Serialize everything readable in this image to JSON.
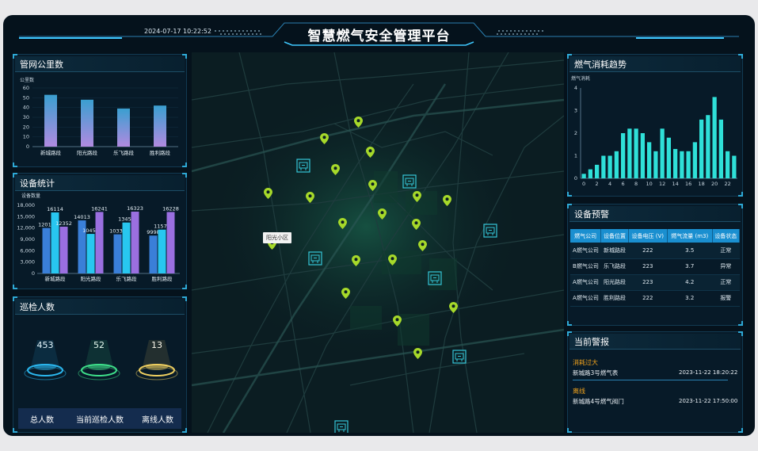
{
  "header": {
    "title": "智慧燃气安全管理平台",
    "datetime": "2024-07-17 10:22:52"
  },
  "pipeline": {
    "title": "管网公里数",
    "chart_data": {
      "type": "bar",
      "ylabel": "公里数",
      "ylim": [
        0,
        60
      ],
      "yticks": [
        0,
        10,
        20,
        30,
        40,
        50,
        60
      ],
      "categories": [
        "新城路段",
        "阳光路段",
        "乐飞路段",
        "胜利路段"
      ],
      "values": [
        53,
        48,
        39,
        42
      ],
      "colors": [
        "#3a9fd0",
        "#b18ae0"
      ]
    }
  },
  "devices": {
    "title": "设备统计",
    "chart_data": {
      "type": "bar",
      "ylabel": "设备数量",
      "ylim": [
        0,
        18000
      ],
      "yticks": [
        0,
        3000,
        6000,
        9000,
        12000,
        15000,
        18000
      ],
      "categories": [
        "新城路段",
        "阳光路段",
        "乐飞路段",
        "胜利路段"
      ],
      "series": [
        {
          "values": [
            12012,
            14013,
            10332,
            9998
          ],
          "color": "#3a7fd8"
        },
        {
          "values": [
            16114,
            10450,
            13451,
            11573
          ],
          "color": "#28c7f0"
        },
        {
          "values": [
            12352,
            16241,
            16323,
            16228
          ],
          "color": "#9a6fe0"
        }
      ]
    }
  },
  "patrol": {
    "title": "巡检人数",
    "items": [
      {
        "count": "453",
        "label": "总人数",
        "color": "#2bb8f0"
      },
      {
        "count": "52",
        "label": "当前巡检人数",
        "color": "#3ee08a"
      },
      {
        "count": "13",
        "label": "离线人数",
        "color": "#f0d060"
      }
    ]
  },
  "map": {
    "area_label": "阳光小区"
  },
  "consumption": {
    "title": "燃气消耗趋势",
    "chart_data": {
      "type": "bar",
      "ylabel": "燃气消耗",
      "ylim": [
        0,
        4
      ],
      "yticks": [
        0,
        1,
        2,
        3,
        4
      ],
      "x": [
        0,
        1,
        2,
        3,
        4,
        5,
        6,
        7,
        8,
        9,
        10,
        11,
        12,
        13,
        14,
        15,
        16,
        17,
        18,
        19,
        20,
        21,
        22,
        23
      ],
      "xticks": [
        0,
        2,
        4,
        6,
        8,
        10,
        12,
        14,
        16,
        18,
        20,
        22
      ],
      "values": [
        0.2,
        0.4,
        0.6,
        1.0,
        1.0,
        1.2,
        2.0,
        2.2,
        2.2,
        2.0,
        1.6,
        1.2,
        2.2,
        1.8,
        1.3,
        1.2,
        1.2,
        1.6,
        2.6,
        2.8,
        3.6,
        2.6,
        1.2,
        1.0
      ],
      "color": "#2fe0d8"
    }
  },
  "alerts": {
    "title": "设备预警",
    "columns": [
      "燃气公司",
      "设备位置",
      "设备电压 (V)",
      "燃气流量 (m3)",
      "设备状态"
    ],
    "rows": [
      [
        "A燃气公司",
        "新城路段",
        "222",
        "3.5",
        "正常"
      ],
      [
        "B燃气公司",
        "乐飞路段",
        "223",
        "3.7",
        "异常"
      ],
      [
        "A燃气公司",
        "阳光路段",
        "223",
        "4.2",
        "正常"
      ],
      [
        "A燃气公司",
        "胜利路段",
        "222",
        "3.2",
        "报警"
      ]
    ]
  },
  "alarms": {
    "title": "当前警报",
    "items": [
      {
        "type": "消耗过大",
        "desc": "新城路3号燃气表",
        "time": "2023-11-22 18:20:22"
      },
      {
        "type": "离线",
        "desc": "新城路4号燃气阀门",
        "time": "2023-11-22 17:50:00"
      }
    ]
  },
  "icons": [
    "location-pin-icon",
    "gas-station-icon"
  ]
}
